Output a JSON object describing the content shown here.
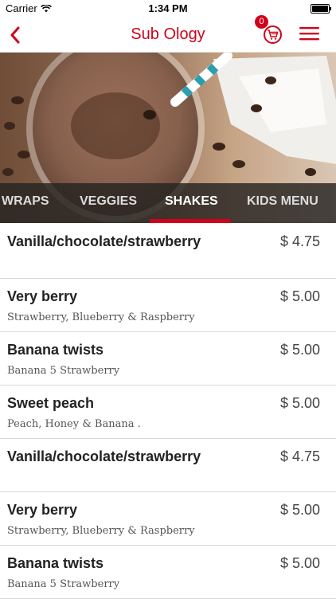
{
  "status_bar": {
    "carrier": "Carrier",
    "time": "1:34 PM",
    "battery_level": 1.0
  },
  "nav": {
    "title": "Sub Ology",
    "cart_count": "0",
    "back_icon": "chevron-left-icon",
    "cart_icon": "cart-icon",
    "menu_icon": "hamburger-icon"
  },
  "hero": {
    "image": "chocolate-shake-photo"
  },
  "categories": {
    "items": [
      "WRAPS",
      "VEGGIES",
      "SHAKES",
      "KIDS MENU"
    ],
    "active": "SHAKES"
  },
  "menu_items": [
    {
      "name": "Vanilla/chocolate/strawberry",
      "price": "$ 4.75",
      "description": ""
    },
    {
      "name": "Very berry",
      "price": "$ 5.00",
      "description": "Strawberry, Blueberry & Raspberry"
    },
    {
      "name": "Banana twists",
      "price": "$ 5.00",
      "description": "Banana 5 Strawberry"
    },
    {
      "name": "Sweet peach",
      "price": "$ 5.00",
      "description": "Peach, Honey & Banana ."
    },
    {
      "name": "Vanilla/chocolate/strawberry",
      "price": "$ 4.75",
      "description": ""
    },
    {
      "name": "Very berry",
      "price": "$ 5.00",
      "description": "Strawberry, Blueberry & Raspberry"
    },
    {
      "name": "Banana twists",
      "price": "$ 5.00",
      "description": "Banana 5 Strawberry"
    }
  ],
  "colors": {
    "accent": "#d0021b",
    "tab_bar": "#262321",
    "divider": "#d9d9d9"
  }
}
